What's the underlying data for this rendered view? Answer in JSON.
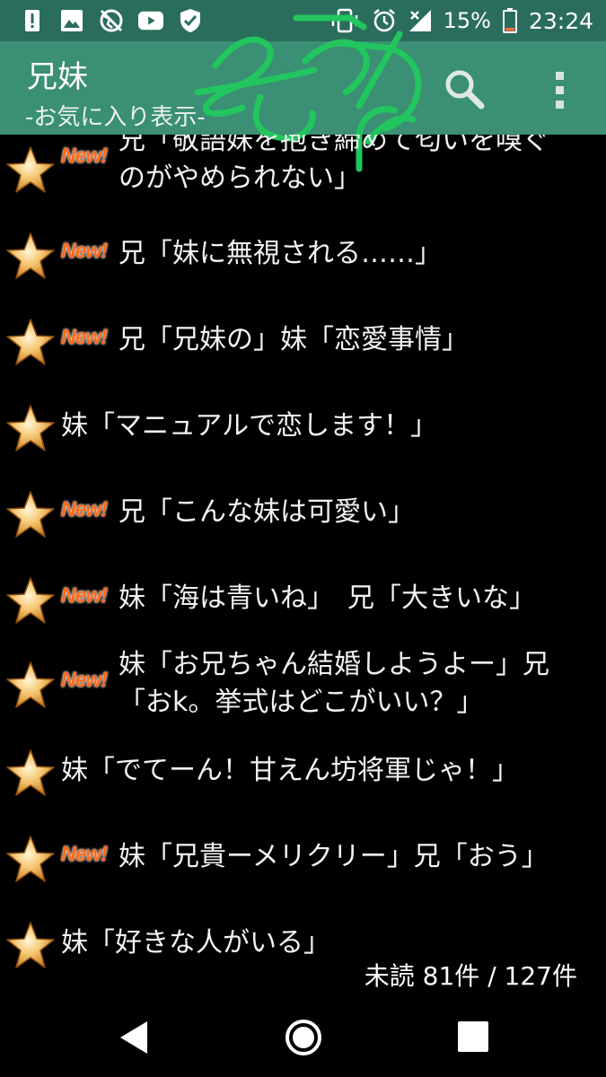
{
  "status_bar": {
    "icons_left": [
      "alert-icon",
      "image-icon",
      "globe-off-icon",
      "youtube-icon",
      "shield-check-icon"
    ],
    "icons_right": [
      "cast-icon",
      "vibrate-icon",
      "alarm-icon",
      "signal-icon"
    ],
    "battery": "15%",
    "time": "23:24"
  },
  "app_bar": {
    "title": "兄妹",
    "subtitle": "-お気に入り表示-",
    "search_icon": "search-icon",
    "menu_icon": "more-vert-icon"
  },
  "colors": {
    "status_bar": "#2b6d5c",
    "app_bar": "#3a8f74",
    "background": "#000000",
    "new_badge": "#ff6a1a",
    "scribble": "#22c55e"
  },
  "new_label": "New!",
  "items": [
    {
      "text_line1": "兄「敬語妹を抱き締めて匂いを嗅ぐ",
      "text_line2": "のがやめられない」",
      "is_new": true
    },
    {
      "text_line1": "兄「妹に無視される……」",
      "text_line2": "",
      "is_new": true
    },
    {
      "text_line1": "兄「兄妹の」妹「恋愛事情」",
      "text_line2": "",
      "is_new": true
    },
    {
      "text_line1": "妹「マニュアルで恋します！」",
      "text_line2": "",
      "is_new": false
    },
    {
      "text_line1": "兄「こんな妹は可愛い」",
      "text_line2": "",
      "is_new": true
    },
    {
      "text_line1": "妹「海は青いね」　兄「大きいな」",
      "text_line2": "",
      "is_new": true
    },
    {
      "text_line1": "妹「お兄ちゃん結婚しようよー」兄",
      "text_line2": "「おk。挙式はどこがいい？」",
      "is_new": true
    },
    {
      "text_line1": "妹「でてーん！甘えん坊将軍じゃ！」",
      "text_line2": "",
      "is_new": false
    },
    {
      "text_line1": "妹「兄貴ーメリクリー」兄「おう」",
      "text_line2": "",
      "is_new": true
    },
    {
      "text_line1": "妹「好きな人がいる」",
      "text_line2": "",
      "is_new": false
    }
  ],
  "footer": {
    "unread_count": "未読 81件 / 127件"
  },
  "nav_bar": {
    "back": "back-icon",
    "home": "home-icon",
    "recent": "recent-apps-icon"
  }
}
